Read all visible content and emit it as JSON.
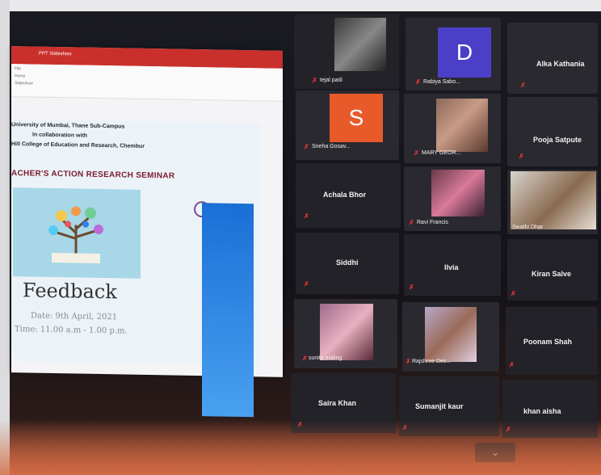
{
  "share": {
    "window_title": "PPT Slideshow",
    "ribbon": [
      "File",
      "Home",
      "Slideshow"
    ],
    "slide": {
      "line1": "University of Mumbai, Thane Sub-Campus",
      "line2": "In collaboration with",
      "line3": "Hill College of Education and Research, Chembur",
      "heading": "ACHER'S ACTION RESEARCH SEMINAR",
      "feedback": "Feedback",
      "date": "Date: 9th April, 2021",
      "time": "Time: 11.00 a.m - 1.00 p.m."
    }
  },
  "participants": [
    {
      "name": "tejal patil",
      "type": "video"
    },
    {
      "name": "Rabiya Sabo...",
      "type": "avatar",
      "initial": "D",
      "color": "#4b3fc8"
    },
    {
      "name": "Alka Kathania",
      "type": "name"
    },
    {
      "name": "Sneha Gosav...",
      "type": "avatar",
      "initial": "S",
      "color": "#e85a2a"
    },
    {
      "name": "MARY GEOR...",
      "type": "video"
    },
    {
      "name": "Pooja Satpute",
      "type": "name"
    },
    {
      "name": "Achala Bhor",
      "type": "name"
    },
    {
      "name": "Ravi Francis",
      "type": "video"
    },
    {
      "name": "Swathi Dhar",
      "type": "video"
    },
    {
      "name": "Siddhi",
      "type": "name"
    },
    {
      "name": "Ilvia",
      "type": "name"
    },
    {
      "name": "Kiran Salve",
      "type": "name"
    },
    {
      "name": "sunita maling",
      "type": "video"
    },
    {
      "name": "Rajshree Des...",
      "type": "video"
    },
    {
      "name": "Poonam Shah",
      "type": "name"
    },
    {
      "name": "Saira Khan",
      "type": "name"
    },
    {
      "name": "Sumanjit kaur",
      "type": "name"
    },
    {
      "name": "khan aisha",
      "type": "name"
    }
  ],
  "controls": {
    "scroll_down": "⌄"
  }
}
